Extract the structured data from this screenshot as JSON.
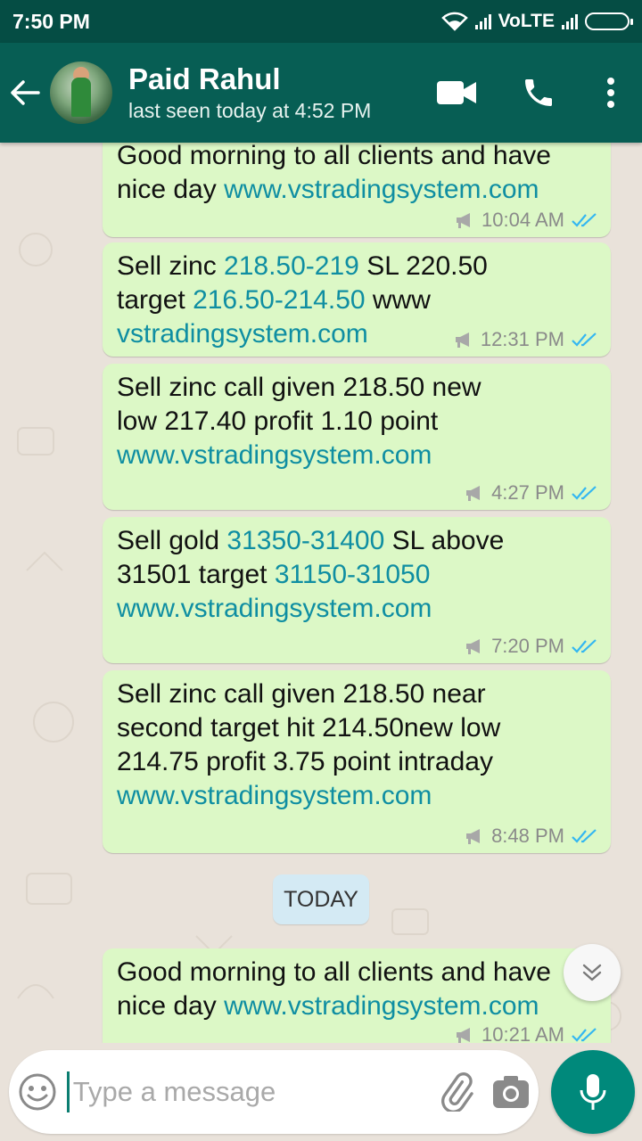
{
  "status_bar": {
    "time": "7:50 PM",
    "network_label": "VoLTE"
  },
  "header": {
    "contact_name": "Paid Rahul",
    "last_seen": "last seen today at 4:52 PM"
  },
  "messages": [
    {
      "text_top": "Good morning to all clients and have",
      "text_a": "nice day ",
      "link": "www.vstradingsystem.com",
      "time": "10:04 AM"
    },
    {
      "p1": "Sell zinc ",
      "l1": "218.50-219",
      "p2": " SL 220.50\ntarget ",
      "l2": "216.50-214.50",
      "p3": " www\n",
      "l3": "vstradingsystem.com",
      "time": "12:31 PM"
    },
    {
      "p1": "Sell zinc call given 218.50 new\nlow 217.40 profit 1.10 point\n",
      "l1": "www.vstradingsystem.com",
      "time": "4:27 PM"
    },
    {
      "p1": "Sell gold ",
      "l1": "31350-31400",
      "p2": " SL above\n31501 target ",
      "l2": "31150-31050",
      "p3": "\n",
      "l3": "www.vstradingsystem.com",
      "time": "7:20 PM"
    },
    {
      "p1": "Sell zinc call given 218.50 near\nsecond target hit 214.50new low\n214.75 profit 3.75 point intraday\n",
      "l1": "www.vstradingsystem.com",
      "time": "8:48 PM"
    },
    {
      "p1": "Good morning to all clients and have\nnice day ",
      "l1": "www.vstradingsystem.com",
      "time": "10:21 AM"
    }
  ],
  "date_divider": "TODAY",
  "composer": {
    "placeholder": "Type a message"
  },
  "colors": {
    "header": "#075e54",
    "status_bar": "#054d44",
    "bubble_out": "#dcf8c6",
    "link": "#0f8ea2",
    "read_ticks": "#34b7f1",
    "mic_button": "#00897b"
  }
}
